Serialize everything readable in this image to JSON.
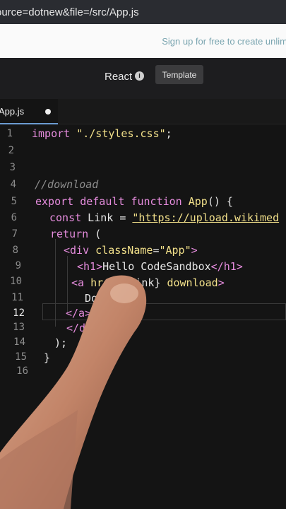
{
  "browser": {
    "url_fragment": "ource=dotnew&file=/src/App.js"
  },
  "banner": {
    "text": "Sign up for free to create unlim"
  },
  "topbar": {
    "framework": "React",
    "template_button": "Template"
  },
  "tabs": [
    {
      "label": "App.js",
      "unsaved": true
    }
  ],
  "editor": {
    "active_line": 12,
    "lines": [
      {
        "n": "1"
      },
      {
        "n": "2"
      },
      {
        "n": "3"
      },
      {
        "n": "4"
      },
      {
        "n": "5"
      },
      {
        "n": "6"
      },
      {
        "n": "7"
      },
      {
        "n": "8"
      },
      {
        "n": "9"
      },
      {
        "n": "10"
      },
      {
        "n": "11"
      },
      {
        "n": "12"
      },
      {
        "n": "13"
      },
      {
        "n": "14"
      },
      {
        "n": "15"
      },
      {
        "n": "16"
      }
    ],
    "code": {
      "l1_kw": "import",
      "l1_str": " \"./styles.css\"",
      "l1_end": ";",
      "l4": "//download",
      "l5_kw": "export default function",
      "l5_fn": " App",
      "l5_end": "() {",
      "l6_kw": "const",
      "l6_mid": " Link = ",
      "l6_str": "\"https://upload.wikimed",
      "l7_kw": "return",
      "l7_end": " (",
      "l8_open": "<div",
      "l8_attr": " className",
      "l8_eq": "=",
      "l8_str": "\"App\"",
      "l8_close": ">",
      "l9_open": "<h1>",
      "l9_text": "Hello CodeSandbox",
      "l9_close": "</h1>",
      "l10_open": "<a",
      "l10_attr": " href",
      "l10_val": "={Link}",
      "l10_attr2": " download",
      "l10_close": ">",
      "l11": "Dow",
      "l12": "</a>",
      "l13": "</d",
      "l14": ");",
      "l15": "}"
    }
  },
  "colors": {
    "keyword": "#e58cdd",
    "string": "#f2e08a",
    "comment": "#8d8d8d",
    "tab_accent": "#6b9bd1"
  }
}
